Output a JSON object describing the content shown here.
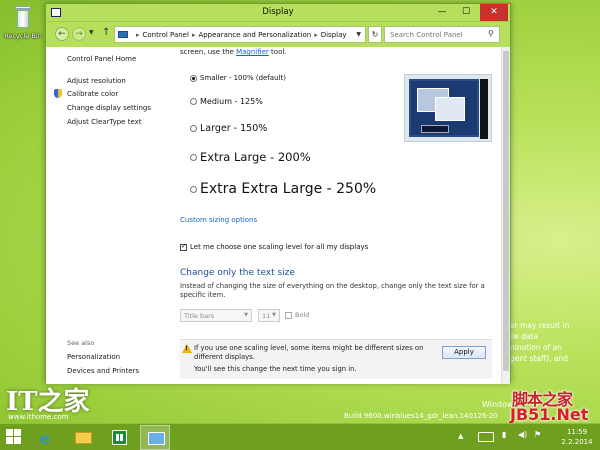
{
  "desktop": {
    "recycle_bin_label": "Recycle Bin",
    "bg_lines": [
      "er may result in",
      "ile data",
      "nination of an",
      "gent staff), and"
    ],
    "build": "Build 9600.winblues14_gdr_lean.140126-20",
    "windows_text": "Windows",
    "watermark_cn": "脚本之家",
    "watermark_jb": "JB51.Net",
    "watermark_it": "IT之家",
    "watermark_it_site": "www.ithome.com"
  },
  "window": {
    "title": "Display",
    "controls": {
      "minimize": "—",
      "maximize": "☐",
      "close": "✕"
    }
  },
  "address": {
    "crumbs": [
      "Control Panel",
      "Appearance and Personalization",
      "Display"
    ],
    "search_placeholder": "Search Control Panel"
  },
  "left_nav": {
    "home": "Control Panel Home",
    "links": [
      "Adjust resolution",
      "Calibrate color",
      "Change display settings",
      "Adjust ClearType text"
    ],
    "see_also_heading": "See also",
    "see_also_links": [
      "Personalization",
      "Devices and Printers"
    ]
  },
  "main": {
    "intro_prefix": "screen, use the",
    "intro_link": "Magnifier",
    "intro_suffix": "tool.",
    "options": [
      {
        "label": "Smaller - 100% (default)",
        "selected": true
      },
      {
        "label": "Medium - 125%",
        "selected": false
      },
      {
        "label": "Larger - 150%",
        "selected": false
      },
      {
        "label": "Extra Large - 200%",
        "selected": false
      },
      {
        "label": "Extra Extra Large - 250%",
        "selected": false
      }
    ],
    "custom_sizing": "Custom sizing options",
    "checkbox_label": "Let me choose one scaling level for all my displays",
    "checkbox_checked": true,
    "text_size_heading": "Change only the text size",
    "text_size_desc": "Instead of changing the size of everything on the desktop, change only the text size for a specific item.",
    "item_select": "Title bars",
    "size_select": "11",
    "bold_label": "Bold",
    "warning": "If you use one scaling level, some items might be different sizes on different displays.",
    "signin_note": "You'll see this change the next time you sign in.",
    "apply": "Apply"
  },
  "taskbar": {
    "ie_glyph": "e",
    "tray_up": "▲",
    "signal": "▮",
    "volume": "◀)",
    "flag": "⚑",
    "time": "11:59",
    "date": "2.2.2014"
  },
  "colors": {
    "accent_green": "#b6e05b",
    "taskbar": "#6e9f1e",
    "link_blue": "#1565c0",
    "heading_blue": "#1e4f9a",
    "close_red": "#c7312c"
  }
}
